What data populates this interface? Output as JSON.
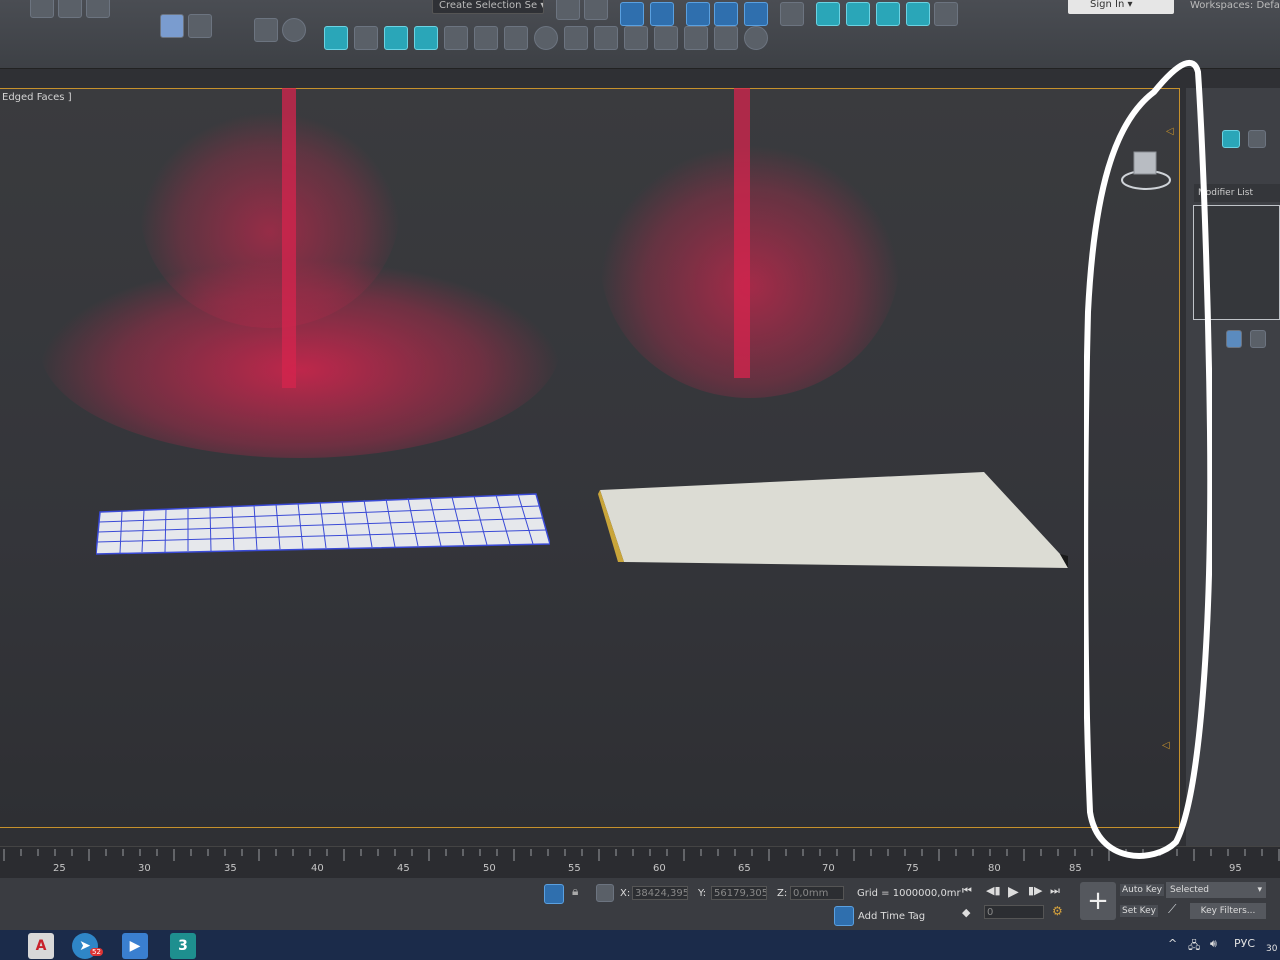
{
  "toolbar": {
    "selection_set_placeholder": "Create Selection Se",
    "sign_in_label": "Sign In",
    "workspaces_label": "Workspaces:",
    "workspaces_value": "Defa"
  },
  "viewport": {
    "label": "Edged Faces ]"
  },
  "command_panel": {
    "modifier_list_label": "Modifier List"
  },
  "timeline": {
    "ticks": [
      "25",
      "30",
      "35",
      "40",
      "45",
      "50",
      "55",
      "60",
      "65",
      "70",
      "75",
      "80",
      "85",
      "95"
    ]
  },
  "status": {
    "x_label": "X:",
    "x_value": "38424,395",
    "y_label": "Y:",
    "y_value": "56179,305",
    "z_label": "Z:",
    "z_value": "0,0mm",
    "grid_label": "Grid = 1000000,0mr",
    "add_time_tag": "Add Time Tag",
    "frame_value": "0",
    "auto_key": "Auto Key",
    "set_key": "Set Key",
    "selected_value": "Selected",
    "key_filters": "Key Filters..."
  },
  "taskbar": {
    "telegram_badge": "52",
    "max_label": "3",
    "language": "РУС",
    "clock_partial": "30"
  },
  "colors": {
    "particles": "#d6244e",
    "viewport_border": "#c6912c",
    "grid_object_edges": "#3a4ad6",
    "taskbar": "#1b2b4a"
  }
}
